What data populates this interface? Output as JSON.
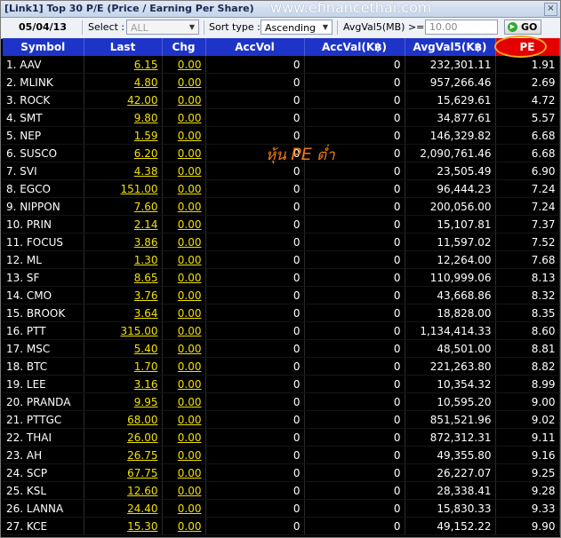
{
  "window": {
    "title": "[Link1] Top 30 P/E (Price / Earning Per Share)",
    "watermark": "www.efinancethai.com",
    "close_glyph": "×"
  },
  "toolbar": {
    "date": "05/04/13",
    "select_label": "Select :",
    "select_value": "ALL",
    "sort_label": "Sort type :",
    "sort_value": "Ascending",
    "avgval_label": "AvgVal5(MB) >=",
    "avgval_value": "10.00",
    "go_label": "GO"
  },
  "annotation": {
    "prefix": "หุ้น ",
    "pe": "PE",
    "suffix": " ต่ำ"
  },
  "columns": [
    "Symbol",
    "Last",
    "Chg",
    "AccVol",
    "AccVal(K฿)",
    "AvgVal5(K฿)",
    "PE"
  ],
  "rows": [
    [
      "1. AAV",
      "6.15",
      "0.00",
      "0",
      "0",
      "232,301.11",
      "1.91"
    ],
    [
      "2. MLINK",
      "4.80",
      "0.00",
      "0",
      "0",
      "957,266.46",
      "2.69"
    ],
    [
      "3. ROCK",
      "42.00",
      "0.00",
      "0",
      "0",
      "15,629.61",
      "4.72"
    ],
    [
      "4. SMT",
      "9.80",
      "0.00",
      "0",
      "0",
      "34,877.61",
      "5.57"
    ],
    [
      "5. NEP",
      "1.59",
      "0.00",
      "0",
      "0",
      "146,329.82",
      "6.68"
    ],
    [
      "6. SUSCO",
      "6.20",
      "0.00",
      "0",
      "0",
      "2,090,761.46",
      "6.68"
    ],
    [
      "7. SVI",
      "4.38",
      "0.00",
      "0",
      "0",
      "23,505.49",
      "6.90"
    ],
    [
      "8. EGCO",
      "151.00",
      "0.00",
      "0",
      "0",
      "96,444.23",
      "7.24"
    ],
    [
      "9. NIPPON",
      "7.60",
      "0.00",
      "0",
      "0",
      "200,056.00",
      "7.24"
    ],
    [
      "10. PRIN",
      "2.14",
      "0.00",
      "0",
      "0",
      "15,107.81",
      "7.37"
    ],
    [
      "11. FOCUS",
      "3.86",
      "0.00",
      "0",
      "0",
      "11,597.02",
      "7.52"
    ],
    [
      "12. ML",
      "1.30",
      "0.00",
      "0",
      "0",
      "12,264.00",
      "7.68"
    ],
    [
      "13. SF",
      "8.65",
      "0.00",
      "0",
      "0",
      "110,999.06",
      "8.13"
    ],
    [
      "14. CMO",
      "3.76",
      "0.00",
      "0",
      "0",
      "43,668.86",
      "8.32"
    ],
    [
      "15. BROOK",
      "3.64",
      "0.00",
      "0",
      "0",
      "18,828.00",
      "8.35"
    ],
    [
      "16. PTT",
      "315.00",
      "0.00",
      "0",
      "0",
      "1,134,414.33",
      "8.60"
    ],
    [
      "17. MSC",
      "5.40",
      "0.00",
      "0",
      "0",
      "48,501.00",
      "8.81"
    ],
    [
      "18. BTC",
      "1.70",
      "0.00",
      "0",
      "0",
      "221,263.80",
      "8.82"
    ],
    [
      "19. LEE",
      "3.16",
      "0.00",
      "0",
      "0",
      "10,354.32",
      "8.99"
    ],
    [
      "20. PRANDA",
      "9.95",
      "0.00",
      "0",
      "0",
      "10,595.20",
      "9.00"
    ],
    [
      "21. PTTGC",
      "68.00",
      "0.00",
      "0",
      "0",
      "851,521.96",
      "9.02"
    ],
    [
      "22. THAI",
      "26.00",
      "0.00",
      "0",
      "0",
      "872,312.31",
      "9.11"
    ],
    [
      "23. AH",
      "26.75",
      "0.00",
      "0",
      "0",
      "49,355.80",
      "9.16"
    ],
    [
      "24. SCP",
      "67.75",
      "0.00",
      "0",
      "0",
      "26,227.07",
      "9.25"
    ],
    [
      "25. KSL",
      "12.60",
      "0.00",
      "0",
      "0",
      "28,338.41",
      "9.28"
    ],
    [
      "26. LANNA",
      "24.40",
      "0.00",
      "0",
      "0",
      "15,830.33",
      "9.33"
    ],
    [
      "27. KCE",
      "15.30",
      "0.00",
      "0",
      "0",
      "49,152.22",
      "9.90"
    ]
  ],
  "colors": {
    "header_bg": "#1e34c8",
    "pe_header_bg": "#e40000",
    "price_text": "#f0e000",
    "annotation": "#f07a10",
    "highlight_oval": "#f5a623"
  }
}
